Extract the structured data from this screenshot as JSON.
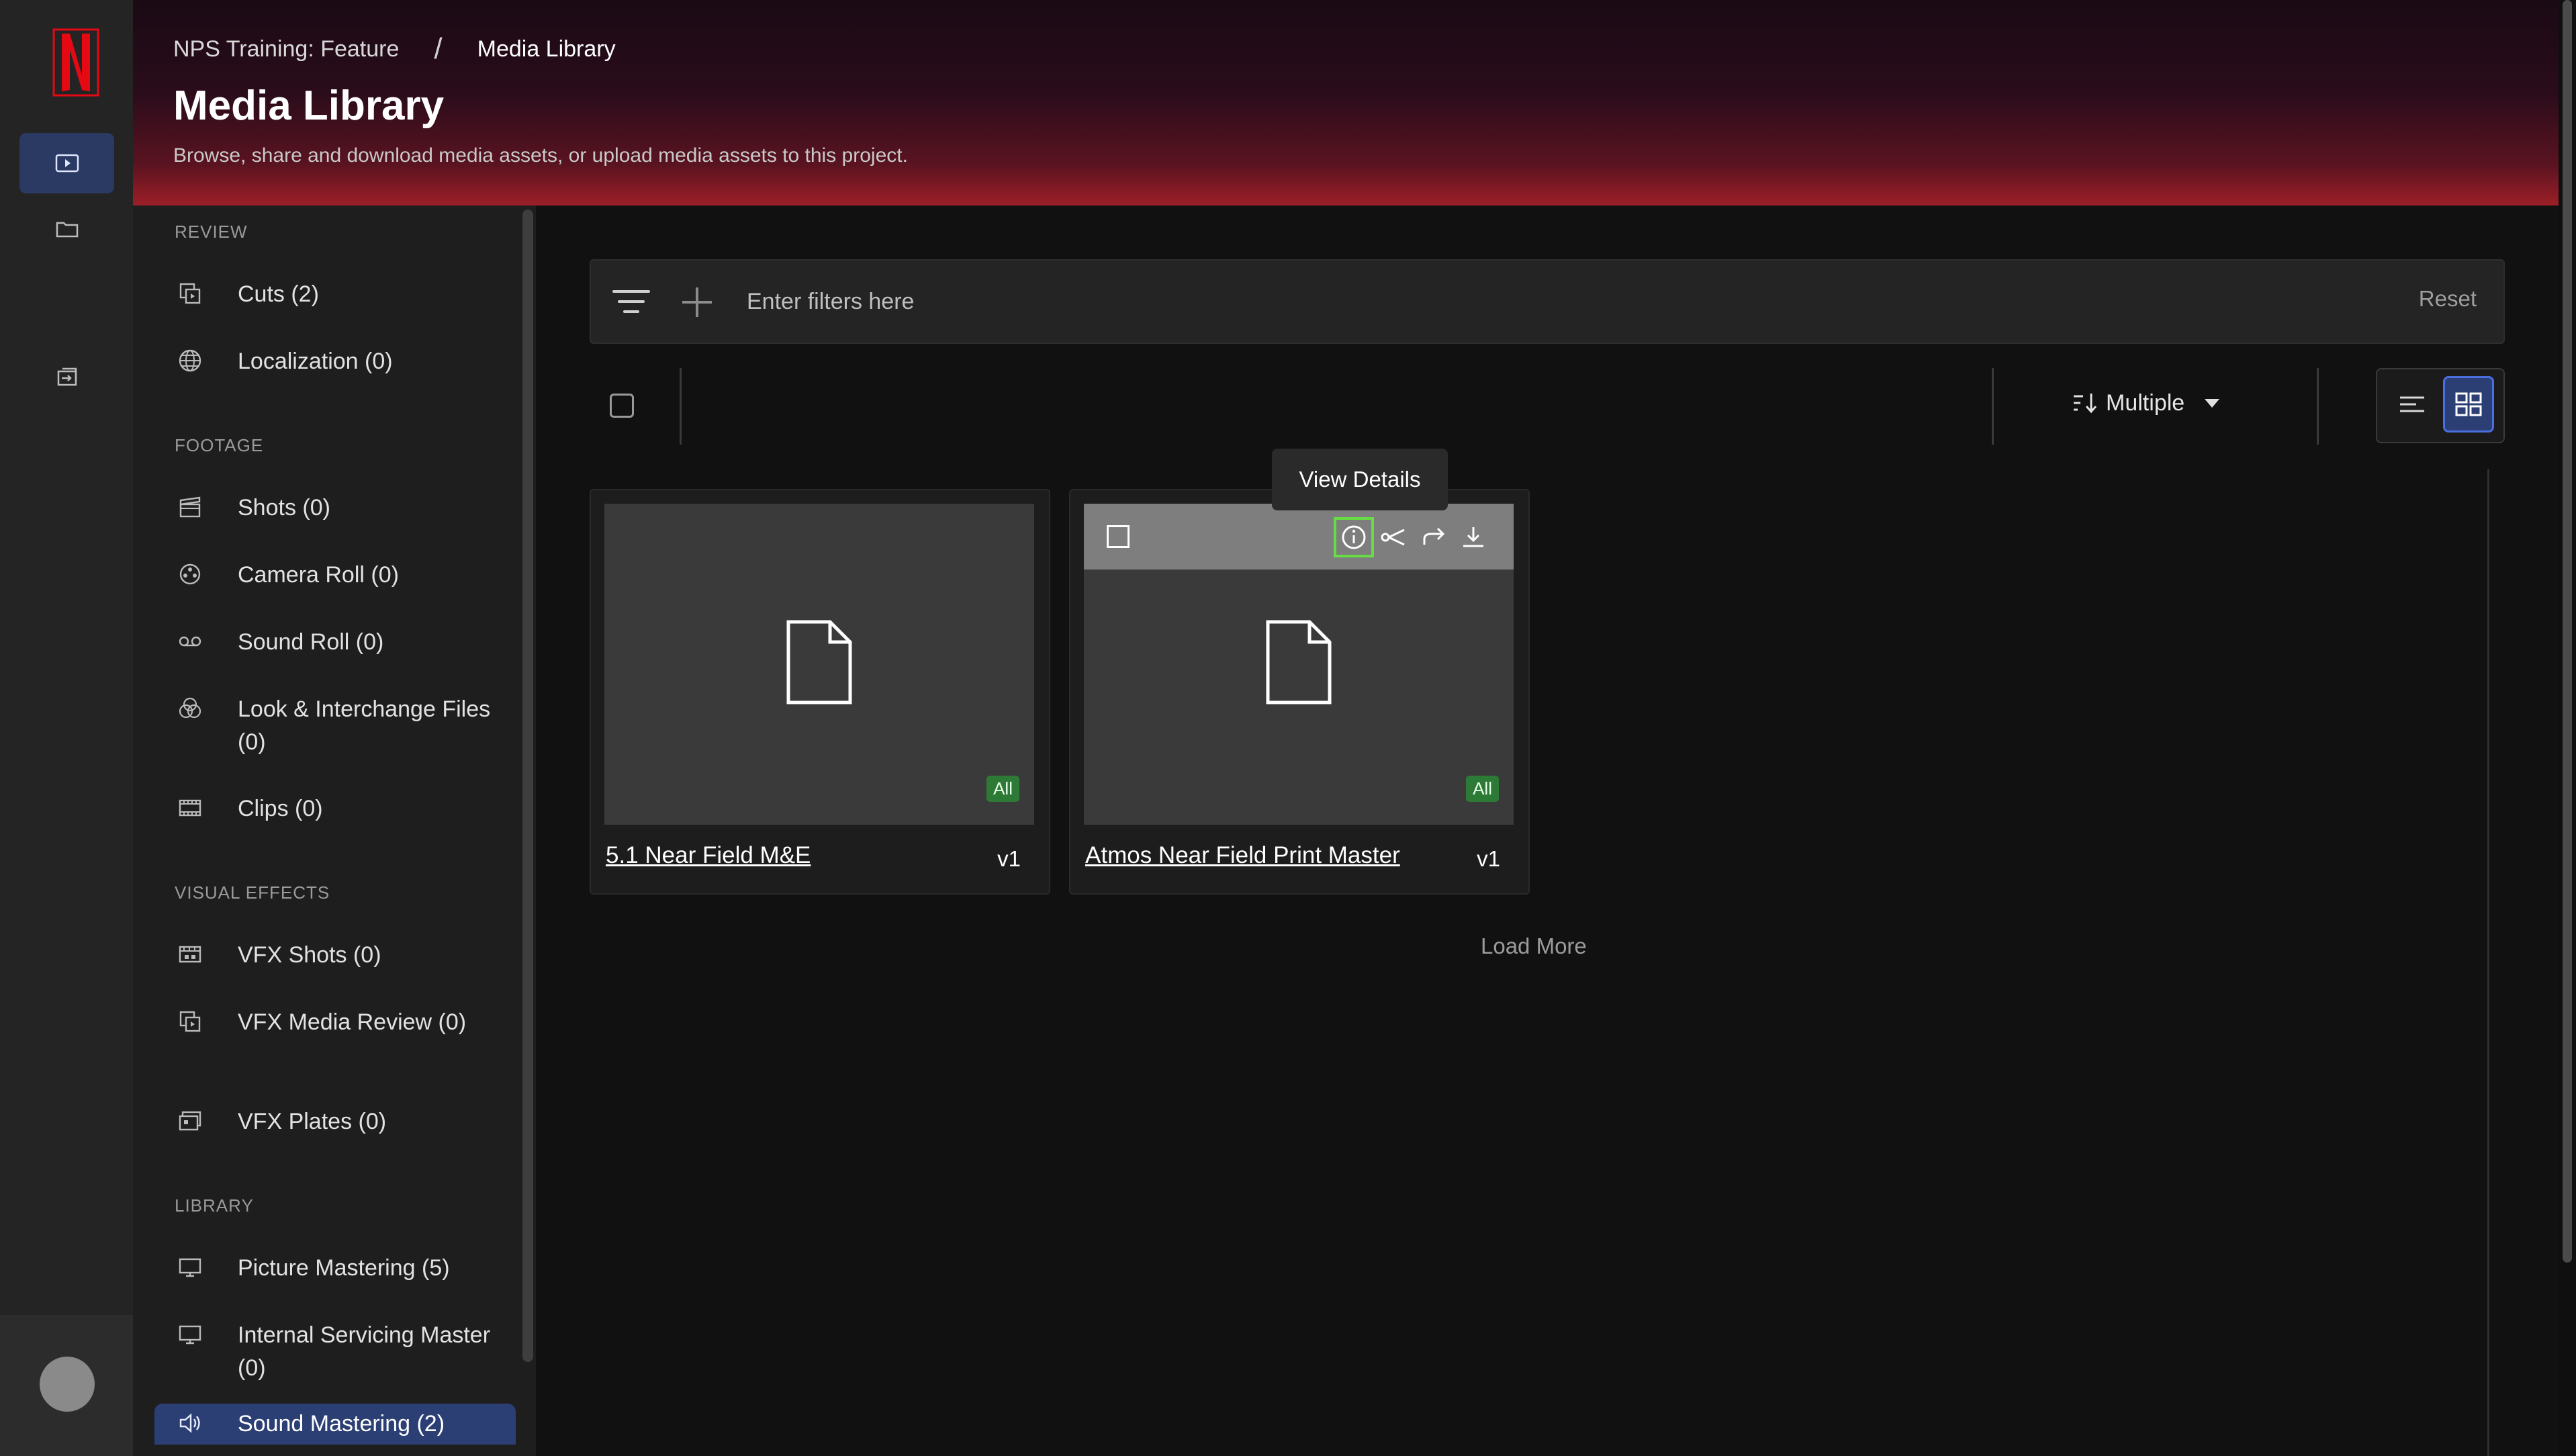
{
  "header": {
    "breadcrumb": [
      "NPS Training: Feature",
      "/",
      "Media Library"
    ],
    "title": "Media Library",
    "description": "Browse, share and download media assets, or upload media assets to this project."
  },
  "sidebar": {
    "sections": [
      {
        "title": "REVIEW",
        "items": [
          {
            "label": "Cuts (2)",
            "icon": "cuts-icon"
          },
          {
            "label": "Localization (0)",
            "icon": "globe-icon"
          }
        ]
      },
      {
        "title": "FOOTAGE",
        "items": [
          {
            "label": "Shots (0)",
            "icon": "clapperboard-icon"
          },
          {
            "label": "Camera Roll (0)",
            "icon": "film-reel-icon"
          },
          {
            "label": "Sound Roll (0)",
            "icon": "tape-icon"
          },
          {
            "label": "Look & Interchange Files (0)",
            "icon": "color-circles-icon"
          },
          {
            "label": "Clips (0)",
            "icon": "film-strip-icon"
          }
        ]
      },
      {
        "title": "VISUAL EFFECTS",
        "items": [
          {
            "label": "VFX Shots (0)",
            "icon": "vfx-clapper-icon"
          },
          {
            "label": "VFX Media Review (0)",
            "icon": "vfx-review-icon"
          },
          {
            "label": "VFX Plates (0)",
            "icon": "vfx-plates-icon"
          }
        ]
      },
      {
        "title": "LIBRARY",
        "items": [
          {
            "label": "Picture Mastering (5)",
            "icon": "monitor-icon"
          },
          {
            "label": "Internal Servicing Master (0)",
            "icon": "monitor-icon"
          },
          {
            "label": "Sound Mastering (2)",
            "icon": "speaker-icon"
          }
        ]
      }
    ]
  },
  "filter": {
    "placeholder": "Enter filters here",
    "reset_label": "Reset"
  },
  "toolbar": {
    "sort_label": "Multiple"
  },
  "cards": [
    {
      "name": "5.1 Near Field M&E",
      "version": "v1",
      "badge": "All"
    },
    {
      "name": "Atmos Near Field Print Master",
      "version": "v1",
      "badge": "All"
    }
  ],
  "tooltip": "View Details",
  "load_more": "Load More",
  "colors": {
    "accent": "#2c3f74",
    "badge": "#2c7a35",
    "highlight": "#66dd44",
    "brand": "#e50914"
  }
}
